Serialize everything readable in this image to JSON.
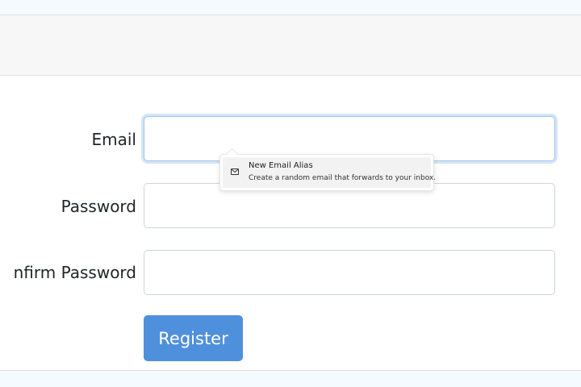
{
  "form": {
    "email_label": "Email",
    "password_label": "Password",
    "confirm_password_label": "nfirm Password",
    "email_value": "",
    "password_value": "",
    "confirm_password_value": "",
    "register_label": "Register"
  },
  "alias_popup": {
    "title": "New Email Alias",
    "subtitle": "Create a random email that forwards to your inbox.",
    "icon": "envelope-icon"
  },
  "colors": {
    "primary": "#4f90dc",
    "focus_ring": "#9ec5e8",
    "header_bg": "#f7f7f7",
    "page_bg": "#f4fafd"
  }
}
